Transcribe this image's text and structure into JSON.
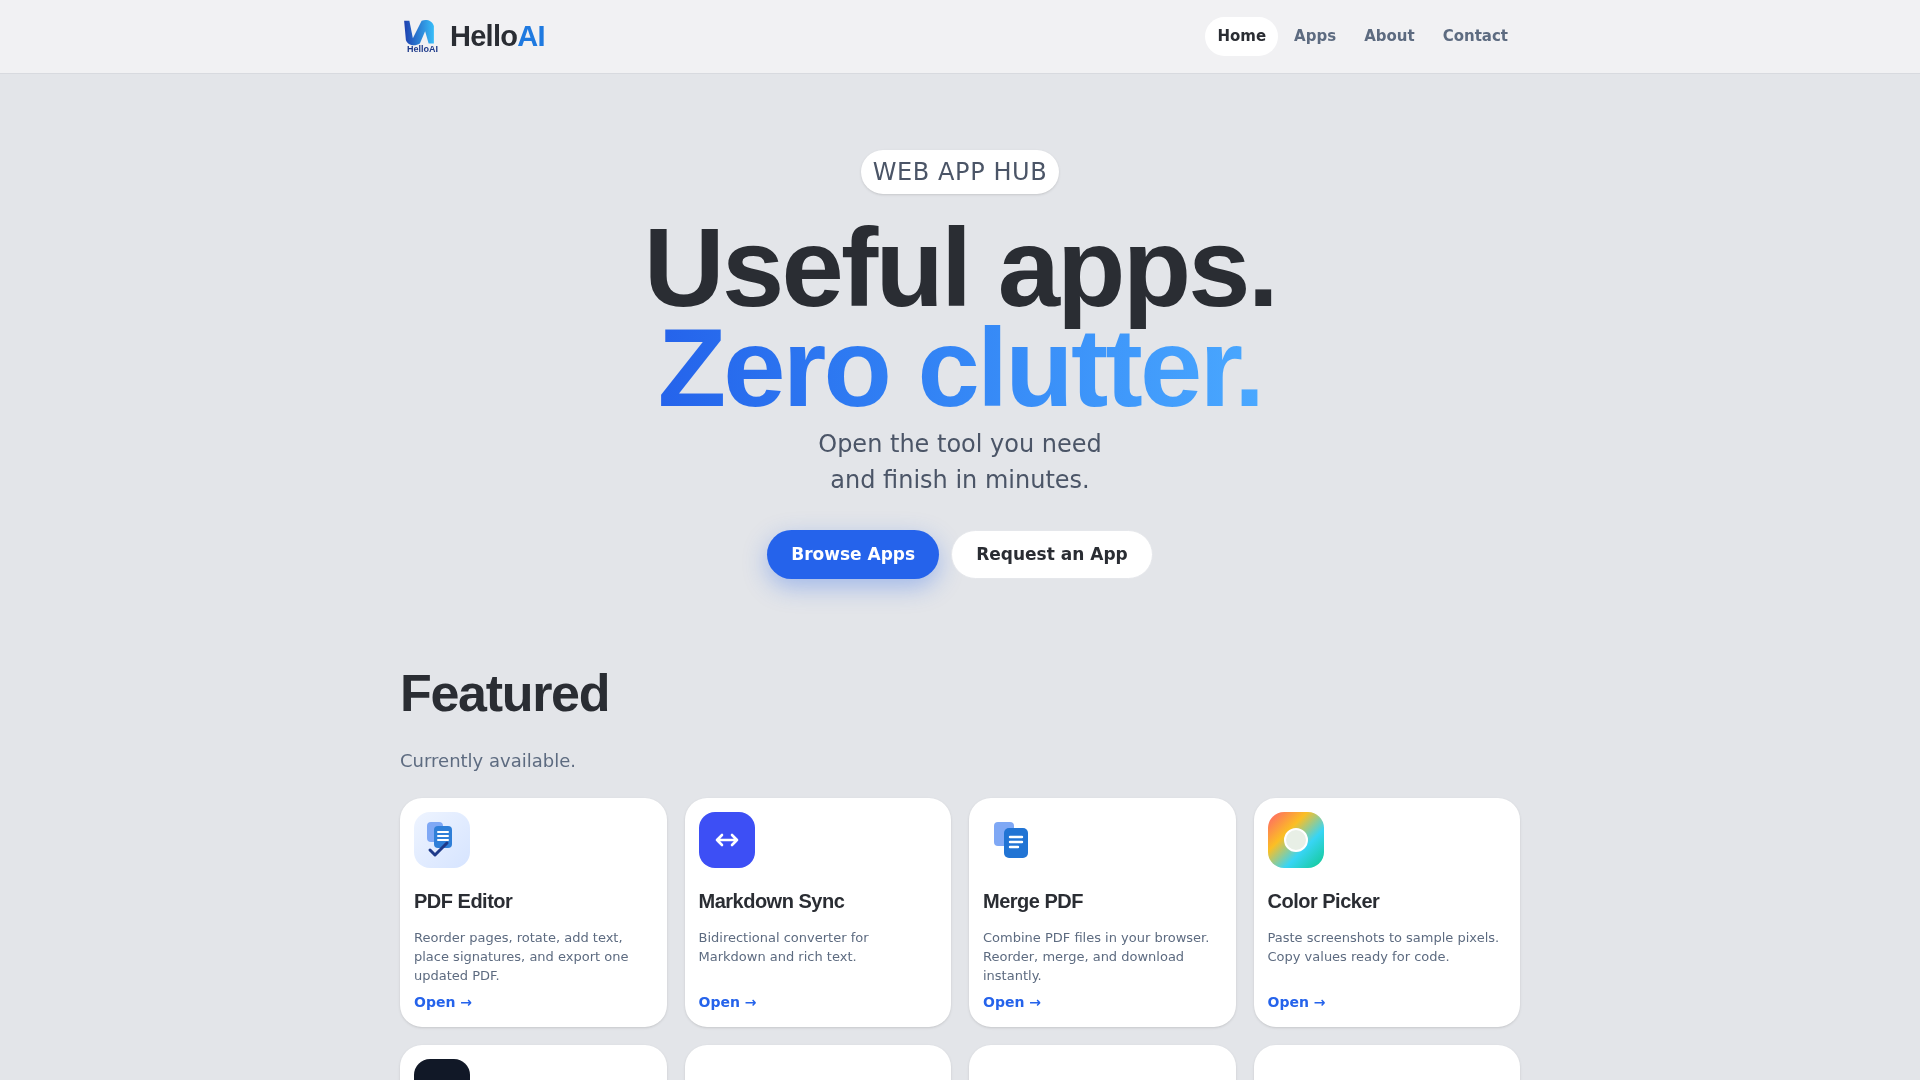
{
  "brand": {
    "name": "Hello",
    "accent": "AI",
    "mark_text": "HelloAI"
  },
  "nav": [
    {
      "label": "Home",
      "selected": true
    },
    {
      "label": "Apps",
      "selected": false
    },
    {
      "label": "About",
      "selected": false
    },
    {
      "label": "Contact",
      "selected": false
    }
  ],
  "hero": {
    "badge": "WEB APP HUB",
    "title": "Useful apps.",
    "title_accent": "Zero clutter.",
    "subtitle_lines": [
      "Open the tool you need",
      "and finish in minutes."
    ],
    "buttons": [
      {
        "label": "Browse Apps",
        "kind": "primary"
      },
      {
        "label": "Request an App",
        "kind": "secondary"
      }
    ]
  },
  "featured": {
    "title": "Featured",
    "subtitle": "Currently available.",
    "cards": [
      {
        "kind": "pdf-edit",
        "title": "PDF Editor",
        "description": "Reorder pages, rotate, add text, place signatures, and export one updated PDF.",
        "link": "Open →"
      },
      {
        "kind": "sync",
        "title": "Markdown Sync",
        "description": "Bidirectional converter for Markdown and rich text.",
        "link": "Open →"
      },
      {
        "kind": "merge",
        "title": "Merge PDF",
        "description": "Combine PDF files in your browser. Reorder, merge, and download instantly.",
        "link": "Open →"
      },
      {
        "kind": "color",
        "title": "Color Picker",
        "description": "Paste screenshots to sample pixels. Copy values ready for code.",
        "link": "Open →"
      }
    ]
  }
}
